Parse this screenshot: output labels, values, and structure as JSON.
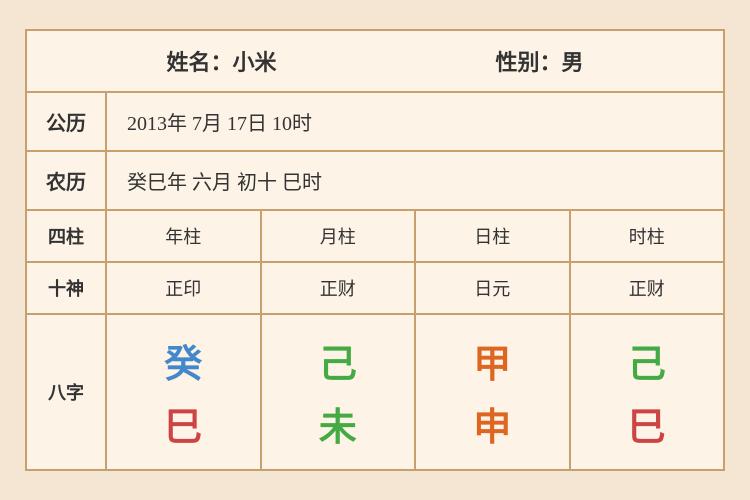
{
  "header": {
    "name_label": "姓名：小米",
    "gender_label": "性别：男"
  },
  "rows": {
    "gregorian_label": "公历",
    "gregorian_value": "2013年 7月 17日 10时",
    "lunar_label": "农历",
    "lunar_value": "癸巳年 六月 初十 巳时"
  },
  "table": {
    "col_label": "四柱",
    "col1": "年柱",
    "col2": "月柱",
    "col3": "日柱",
    "col4": "时柱",
    "shen_label": "十神",
    "shen1": "正印",
    "shen2": "正财",
    "shen3": "日元",
    "shen4": "正财",
    "bazi_label": "八字",
    "bazi1_top": "癸",
    "bazi1_bottom": "巳",
    "bazi2_top": "己",
    "bazi2_bottom": "未",
    "bazi3_top": "甲",
    "bazi3_bottom": "申",
    "bazi4_top": "己",
    "bazi4_bottom": "巳"
  }
}
